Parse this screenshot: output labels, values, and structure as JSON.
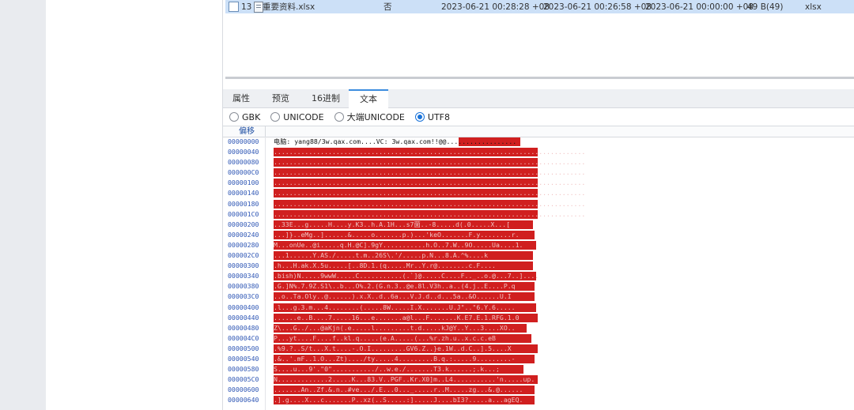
{
  "file_row": {
    "index": "13",
    "name": "重要资料.xlsx",
    "flag": "否",
    "time1": "2023-06-21 00:28:28 +08",
    "time2": "2023-06-21 00:26:58 +08",
    "time3": "2023-06-21 00:00:00 +08",
    "size": "49 B(49)",
    "ext": "xlsx"
  },
  "tabs": [
    {
      "label": "属性"
    },
    {
      "label": "预览"
    },
    {
      "label": "16进制"
    },
    {
      "label": "文本",
      "active": true
    }
  ],
  "encodings": [
    {
      "label": "GBK",
      "selected": false
    },
    {
      "label": "UNICODE",
      "selected": false
    },
    {
      "label": "大端UNICODE",
      "selected": false
    },
    {
      "label": "UTF8",
      "selected": true
    }
  ],
  "hex_header": {
    "offset_label": "偏移"
  },
  "rows": [
    {
      "offset": "00000000",
      "text": "电脑: yang88/3w.qax.com....VC: 3w.qax.com!!@@.................."
    },
    {
      "offset": "00000040",
      "text": "................................................................................"
    },
    {
      "offset": "00000080",
      "text": "................................................................................"
    },
    {
      "offset": "000000C0",
      "text": "................................................................................"
    },
    {
      "offset": "00000100",
      "text": "................................................................................"
    },
    {
      "offset": "00000140",
      "text": "................................................................................"
    },
    {
      "offset": "00000180",
      "text": "................................................................................"
    },
    {
      "offset": "000001C0",
      "text": "................................................................................"
    },
    {
      "offset": "00000200",
      "text": "..33E...g.....H....y.K3..h.A.1H...s7菌..-8.....d(.0.....X...["
    },
    {
      "offset": "00000240",
      "text": "...]}..eMg..]......&.....o.......p.)...'keO.......F.y........r."
    },
    {
      "offset": "00000280",
      "text": "M...onUe..@i.....q.H.@C].9gY...........h.O..7.W..9O.....Ua....1."
    },
    {
      "offset": "000002C0",
      "text": "...1......Y.AS./.....t.m..26S\\.'/.....p.N...8.A.^%....k"
    },
    {
      "offset": "00000300",
      "text": ".h...H.ak.X.5u.....[..8D.1.(q.....Mr..Y.r@........c.F...."
    },
    {
      "offset": "00000340",
      "text": ".bish)N.....9wwW.....C...........(.`]@.....C....F.._..o.@...7..]...."
    },
    {
      "offset": "00000380",
      "text": ".G.]N%.7.9Z.S1\\..b...O%.2.(G.n.3..@e.8l.V3h..a..(4.j..E....P.q"
    },
    {
      "offset": "000003C0",
      "text": "..o..Ta.Oly..@......).x.X..d..6a...V.J.d..d...5a..&O......U.I"
    },
    {
      "offset": "00000400",
      "text": ".l...g.3.m...4........(.....8W.....I.X.......U.J\"..\"6.Y.6....."
    },
    {
      "offset": "00000440",
      "text": "......e..B....7.....16...e.......a@l...F.......K.E7.E.1.RFG.1.0"
    },
    {
      "offset": "00000480",
      "text": "Z\\...G../...@aKjn(.e.....l.........t.d.....kJ@Y..Y...3....XO.."
    },
    {
      "offset": "000004C0",
      "text": "P...yt....F....f..kl.q.....(e.A.....(...%r.zh.u..x.c.c.eB"
    },
    {
      "offset": "00000500",
      "text": ".%9.?..S/t...X.t....-.O.I.........GV6.Z..}e.1W..d.C..].5....X"
    },
    {
      "offset": "00000540",
      "text": ".&..'.mF..1.O...Zt)..../ty.....4.........B.q.:.....9.........-"
    },
    {
      "offset": "00000580",
      "text": "S....u...9'.\"0\".........../..w.e./.......T3.k......;.k...;"
    },
    {
      "offset": "000005C0",
      "text": "N.............2.....K...83.V..PGF..Kr.X0]m..L4...........'n.....up."
    },
    {
      "offset": "00000600",
      "text": ".......An..Zf.&.n..#ve.../.E...0..._.....r..M.....zg...&.@......"
    },
    {
      "offset": "00000640",
      "text": ".].g....X...c.......P..xz(..S.....:].....J....bI3?.....a...agEQ."
    }
  ]
}
